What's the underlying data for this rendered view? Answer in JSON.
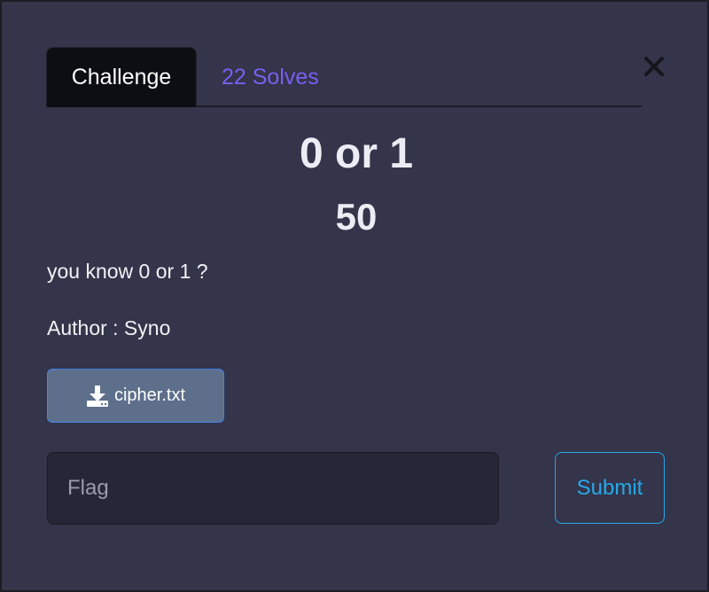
{
  "tabs": {
    "challenge_label": "Challenge",
    "solves_label": "22 Solves"
  },
  "close": {
    "icon": "close-icon"
  },
  "challenge": {
    "title": "0 or 1",
    "points": "50",
    "description": "you know 0 or 1 ?",
    "author": "Author : Syno"
  },
  "file": {
    "icon": "download-icon",
    "name": "cipher.txt"
  },
  "flag": {
    "placeholder": "Flag",
    "value": ""
  },
  "submit": {
    "label": "Submit"
  },
  "colors": {
    "background": "#34344a",
    "active_tab": "#0d0d14",
    "solves_link": "#7a5ff0",
    "file_button": "#5d6f8a",
    "submit_accent": "#26a9e8"
  }
}
